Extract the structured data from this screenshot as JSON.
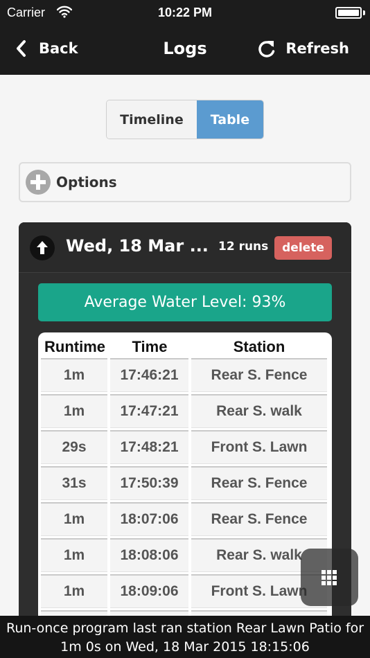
{
  "status_bar": {
    "carrier": "Carrier",
    "time": "10:22 PM"
  },
  "nav": {
    "back": "Back",
    "title": "Logs",
    "refresh": "Refresh"
  },
  "view_toggle": {
    "timeline": "Timeline",
    "table": "Table",
    "selected": "Table"
  },
  "options": {
    "label": "Options"
  },
  "log_group": {
    "date": "Wed, 18 Mar ...",
    "runs": "12 runs",
    "delete": "delete",
    "average": "Average Water Level: 93%",
    "columns": [
      "Runtime",
      "Time",
      "Station"
    ],
    "rows": [
      {
        "runtime": "1m",
        "time": "17:46:21",
        "station": "Rear S. Fence"
      },
      {
        "runtime": "1m",
        "time": "17:47:21",
        "station": "Rear S. walk"
      },
      {
        "runtime": "29s",
        "time": "17:48:21",
        "station": "Front S. Lawn"
      },
      {
        "runtime": "31s",
        "time": "17:50:39",
        "station": "Rear S. Fence"
      },
      {
        "runtime": "1m",
        "time": "18:07:06",
        "station": "Rear S. Fence"
      },
      {
        "runtime": "1m",
        "time": "18:08:06",
        "station": "Rear S. walk"
      },
      {
        "runtime": "1m",
        "time": "18:09:06",
        "station": "Front S. Lawn"
      }
    ]
  },
  "footer": {
    "line1": "Run-once program last ran station Rear Lawn Patio for",
    "line2": "1m 0s on Wed, 18 Mar 2015 18:15:06"
  },
  "icons": {
    "back": "chevron-left-icon",
    "refresh": "refresh-icon",
    "options": "plus-circle-icon",
    "collapse": "arrow-up-icon",
    "menu": "grid-icon",
    "wifi": "wifi-icon",
    "battery": "battery-icon"
  },
  "colors": {
    "header_bg": "#1c1c1c",
    "selected_tab": "#5b9bd0",
    "delete": "#d6625e",
    "average_bar": "#1aa58a",
    "card_bg": "#2e2e2e"
  }
}
